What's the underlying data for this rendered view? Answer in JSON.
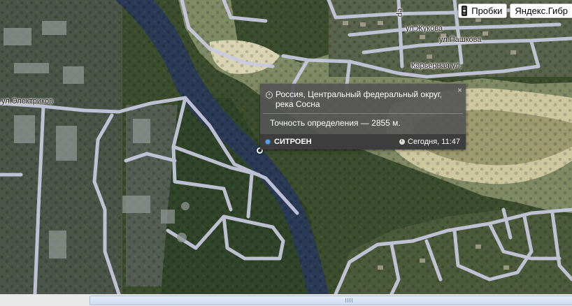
{
  "map": {
    "streets": {
      "elektrikov": "ул.Электриков",
      "zhukova": "ул.Жукова",
      "pashkova": "ул.Пашкова",
      "karernaya": "Карьерная ул.",
      "vertical_top": "ер"
    }
  },
  "toolbar": {
    "traffic_label": "Пробки",
    "layers_label": "Яндекс.Гибр"
  },
  "balloon": {
    "address": "Россия, Центральный федеральный округ, река Сосна",
    "accuracy": "Точность определения — 2855 м.",
    "object_name": "СИТРОЕН",
    "time": "Сегодня, 11:47",
    "close_symbol": "×"
  },
  "colors": {
    "balloon_bg": "#555555",
    "road": "#c9cbe0",
    "river": "#2b3a55",
    "accent_dot": "#4aa3ff"
  }
}
